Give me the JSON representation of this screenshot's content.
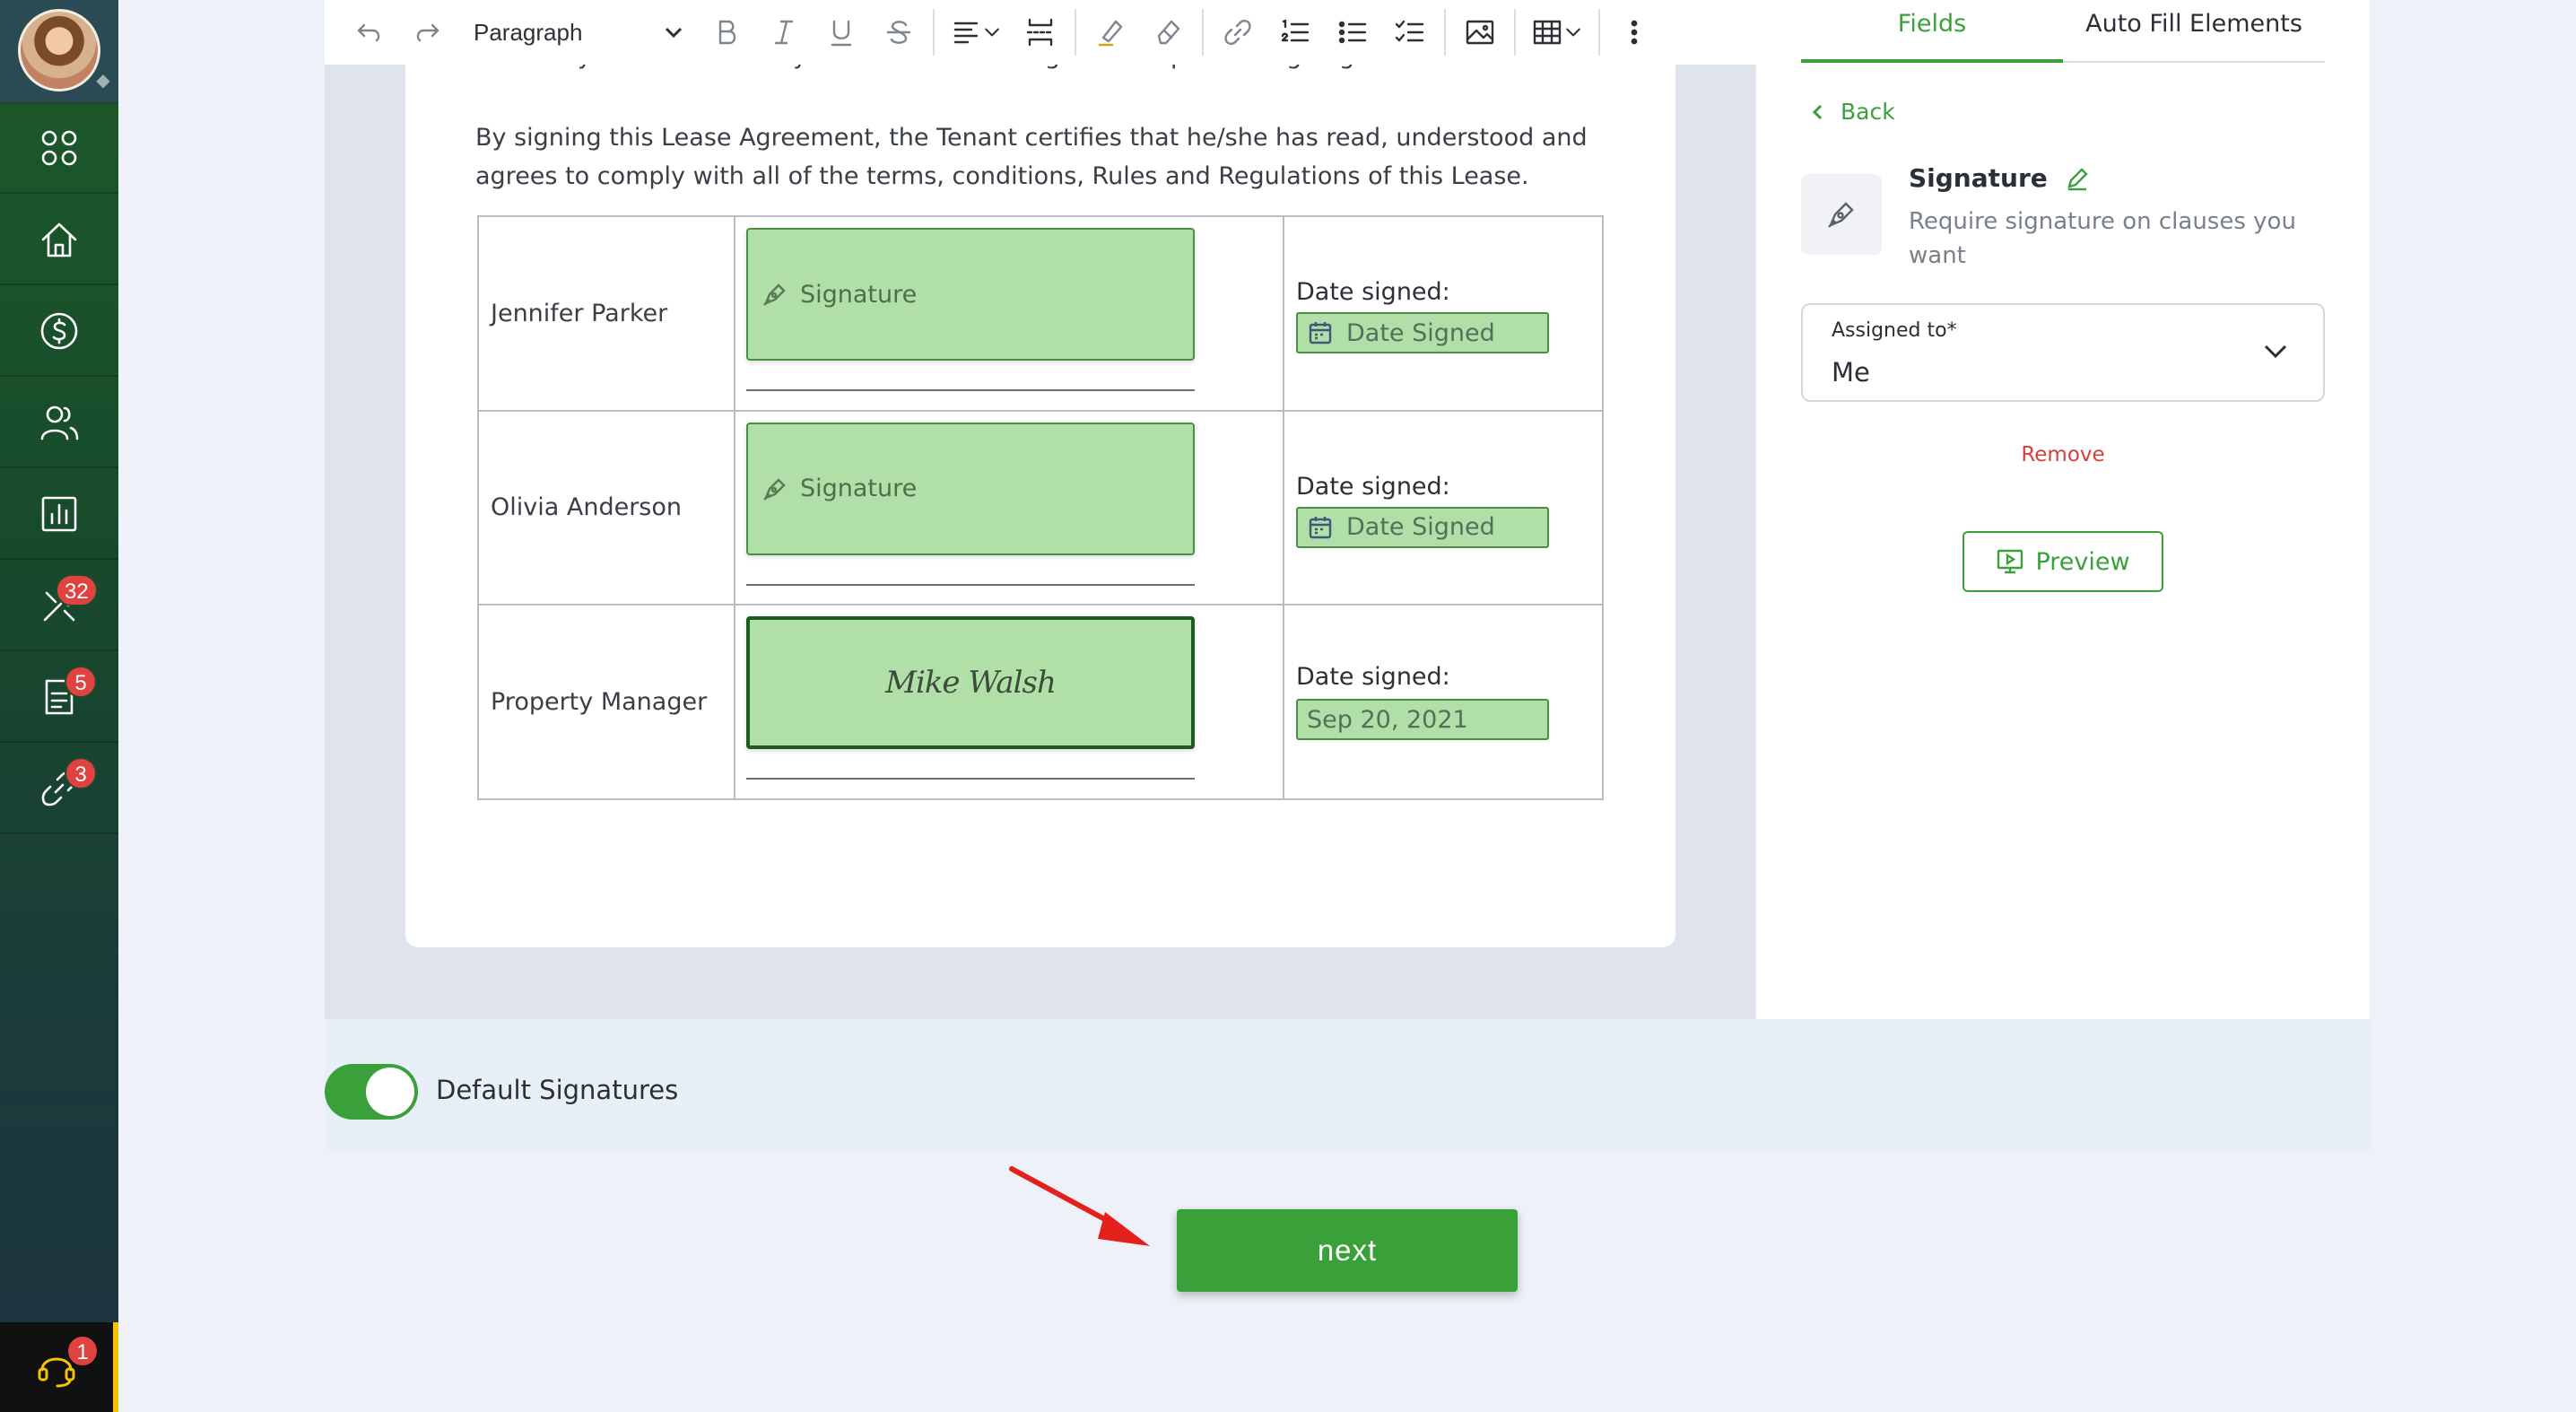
{
  "sidebar": {
    "items": [
      {
        "name": "apps",
        "icon": "grid-icon",
        "badge": ""
      },
      {
        "name": "home",
        "icon": "home-icon",
        "badge": ""
      },
      {
        "name": "payments",
        "icon": "dollar-icon",
        "badge": ""
      },
      {
        "name": "contacts",
        "icon": "people-icon",
        "badge": ""
      },
      {
        "name": "reports",
        "icon": "chart-icon",
        "badge": ""
      },
      {
        "name": "maintenance",
        "icon": "tools-icon",
        "badge": "32"
      },
      {
        "name": "documents",
        "icon": "document-icon",
        "badge": "5"
      },
      {
        "name": "links",
        "icon": "link-icon",
        "badge": "3"
      }
    ],
    "support_badge": "1"
  },
  "toolbar": {
    "block_type": "Paragraph"
  },
  "document": {
    "cut_line": "•You may have an attorney review the Lease Agreement prior to signing it.",
    "paragraph": "By signing this Lease Agreement, the Tenant certifies that he/she has read, understood and agrees to comply with all of the terms, conditions, Rules and Regulations of this Lease.",
    "signers": [
      {
        "name": "Jennifer Parker",
        "signature": "Signature",
        "date_label": "Date signed:",
        "date_value": "Date Signed"
      },
      {
        "name": "Olivia Anderson",
        "signature": "Signature",
        "date_label": "Date signed:",
        "date_value": "Date Signed"
      },
      {
        "name": "Property Manager",
        "signature": "Mike Walsh",
        "date_label": "Date signed:",
        "date_value": "Sep 20, 2021"
      }
    ]
  },
  "panel": {
    "tabs": [
      "Fields",
      "Auto Fill Elements"
    ],
    "active_tab": "Fields",
    "back_label": "Back",
    "field_title": "Signature",
    "field_desc": "Require signature on clauses you want",
    "assigned_label": "Assigned to*",
    "assigned_value": "Me",
    "remove_label": "Remove",
    "preview_label": "Preview"
  },
  "footer": {
    "toggle_label": "Default Signatures",
    "toggle_on": true,
    "next_label": "next"
  },
  "colors": {
    "accent": "#3aa03a",
    "field_fill": "#b0dfa8",
    "danger": "#d4403d",
    "badge": "#e0433f",
    "annotation_arrow": "#e3201b"
  }
}
